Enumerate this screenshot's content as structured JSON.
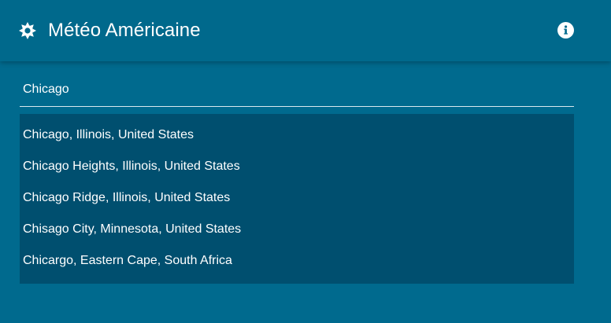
{
  "header": {
    "title": "Météo Américaine",
    "logo_icon": "sun-icon",
    "info_icon": "info-icon"
  },
  "search": {
    "value": "Chicago",
    "placeholder": ""
  },
  "suggestions": [
    "Chicago, Illinois, United States",
    "Chicago Heights, Illinois, United States",
    "Chicago Ridge, Illinois, United States",
    "Chisago City, Minnesota, United States",
    "Chicargo, Eastern Cape, South Africa"
  ],
  "colors": {
    "background": "#006a8e",
    "header": "#00698c",
    "dropdown": "#004f6f",
    "text": "#ffffff"
  }
}
